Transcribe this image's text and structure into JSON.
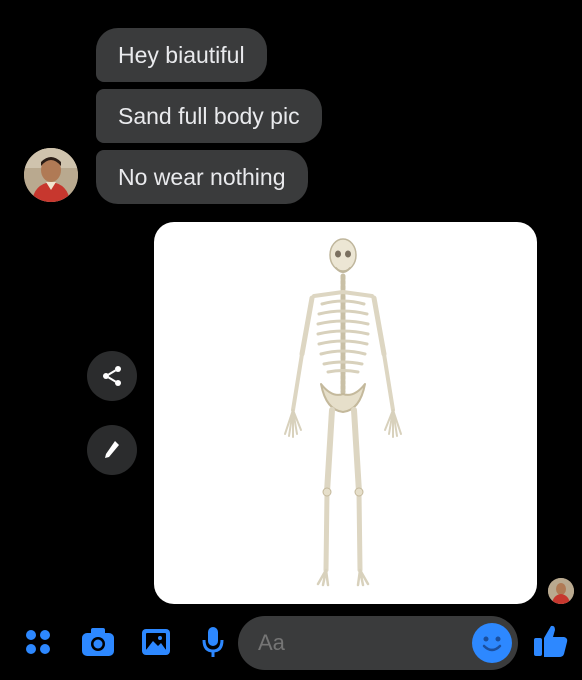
{
  "messages": [
    {
      "text": "Hey biautiful"
    },
    {
      "text": "Sand full body pic"
    },
    {
      "text": "No wear nothing"
    }
  ],
  "composer": {
    "placeholder": "Aa",
    "icons": [
      "menu-dots-icon",
      "camera-icon",
      "gallery-icon",
      "microphone-icon",
      "emoji-icon",
      "thumbs-up-icon"
    ]
  },
  "colors": {
    "background": "#000000",
    "bubble": "#3a3b3c",
    "accent": "#2d88ff"
  }
}
